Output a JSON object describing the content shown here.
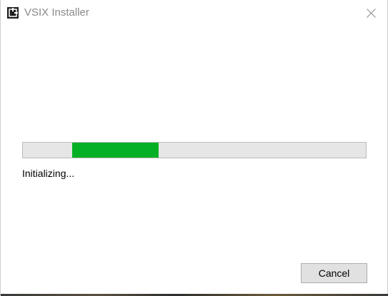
{
  "window": {
    "title": "VSIX Installer",
    "app_icon": "vsix-installer-icon",
    "close_icon": "close-icon"
  },
  "progress": {
    "value_fraction_start": 0.143,
    "value_fraction_width": 0.252,
    "indeterminate": true,
    "fill_color": "#06b025",
    "track_color": "#e6e6e6"
  },
  "status": {
    "text": "Initializing..."
  },
  "actions": {
    "cancel_label": "Cancel"
  }
}
